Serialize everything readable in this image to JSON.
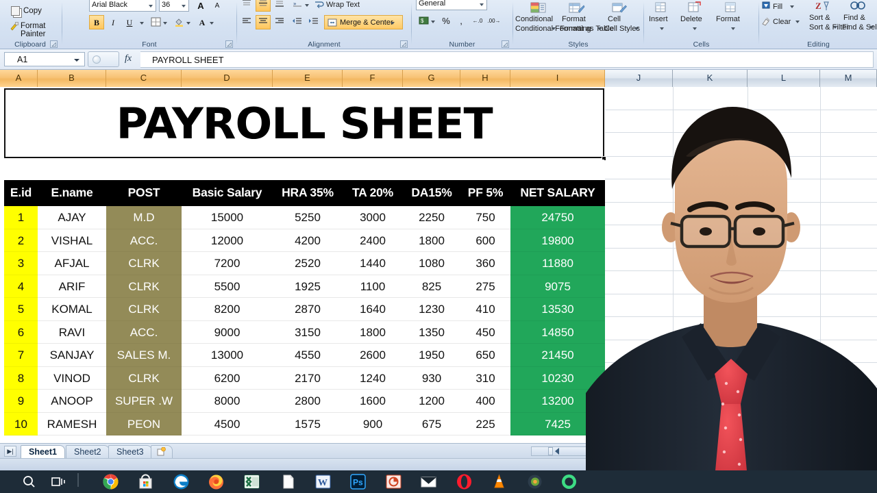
{
  "ribbon": {
    "groups": [
      {
        "name": "Clipboard",
        "label": "Clipboard"
      },
      {
        "name": "Font",
        "label": "Font"
      },
      {
        "name": "Alignment",
        "label": "Alignment"
      },
      {
        "name": "Number",
        "label": "Number"
      },
      {
        "name": "Styles",
        "label": "Styles"
      },
      {
        "name": "Cells",
        "label": "Cells"
      },
      {
        "name": "Editing",
        "label": "Editing"
      }
    ],
    "clipboard": {
      "copy": "Copy",
      "format_painter": "Format Painter"
    },
    "font": {
      "font_name": "Arial Black",
      "font_size": "36",
      "grow_font": "A",
      "shrink_font": "A",
      "bold": "B",
      "italic": "I",
      "underline": "U"
    },
    "alignment": {
      "wrap_text": "Wrap Text",
      "merge_center": "Merge & Center"
    },
    "number": {
      "format": "General",
      "percent": "%",
      "comma": ",",
      "increase_decimal": ".0",
      "decrease_decimal": ".00"
    },
    "styles": {
      "conditional_formatting": "Conditional Formatting",
      "format_as_table": "Format as Table",
      "cell_styles": "Cell Styles"
    },
    "cells": {
      "insert": "Insert",
      "delete": "Delete",
      "format": "Format"
    },
    "editing": {
      "fill": "Fill",
      "clear": "Clear",
      "sort_filter": "Sort & Filter",
      "find_select": "Find & Select"
    }
  },
  "formula_bar": {
    "name_box": "A1",
    "fx_label": "fx",
    "formula_value": "PAYROLL SHEET"
  },
  "grid": {
    "column_headers": [
      "A",
      "B",
      "C",
      "D",
      "E",
      "F",
      "G",
      "H",
      "I",
      "J",
      "K",
      "L",
      "M"
    ],
    "selected_columns": [
      "A",
      "B",
      "C",
      "D",
      "E",
      "F",
      "G",
      "H",
      "I"
    ],
    "title_cell": "PAYROLL SHEET"
  },
  "colors": {
    "id_fill": "#FFFF00",
    "post_fill": "#938B58",
    "net_salary_fill": "#21A75A",
    "header_fill": "#000000",
    "header_text": "#FFFFFF",
    "ribbon_highlight": "#FFC65C"
  },
  "chart_data": {
    "type": "table",
    "title": "PAYROLL SHEET",
    "columns": [
      "E.id",
      "E.name",
      "POST",
      "Basic Salary",
      "HRA 35%",
      "TA 20%",
      "DA15%",
      "PF 5%",
      "NET SALARY"
    ],
    "rows": [
      [
        "1",
        "AJAY",
        "M.D",
        "15000",
        "5250",
        "3000",
        "2250",
        "750",
        "24750"
      ],
      [
        "2",
        "VISHAL",
        "ACC.",
        "12000",
        "4200",
        "2400",
        "1800",
        "600",
        "19800"
      ],
      [
        "3",
        "AFJAL",
        "CLRK",
        "7200",
        "2520",
        "1440",
        "1080",
        "360",
        "11880"
      ],
      [
        "4",
        "ARIF",
        "CLRK",
        "5500",
        "1925",
        "1100",
        "825",
        "275",
        "9075"
      ],
      [
        "5",
        "KOMAL",
        "CLRK",
        "8200",
        "2870",
        "1640",
        "1230",
        "410",
        "13530"
      ],
      [
        "6",
        "RAVI",
        "ACC.",
        "9000",
        "3150",
        "1800",
        "1350",
        "450",
        "14850"
      ],
      [
        "7",
        "SANJAY",
        "SALES M.",
        "13000",
        "4550",
        "2600",
        "1950",
        "650",
        "21450"
      ],
      [
        "8",
        "VINOD",
        "CLRK",
        "6200",
        "2170",
        "1240",
        "930",
        "310",
        "10230"
      ],
      [
        "9",
        "ANOOP",
        "SUPER .W",
        "8000",
        "2800",
        "1600",
        "1200",
        "400",
        "13200"
      ],
      [
        "10",
        "RAMESH",
        "PEON",
        "4500",
        "1575",
        "900",
        "675",
        "225",
        "7425"
      ]
    ]
  },
  "sheet_tabs": {
    "nav_first": "▶|",
    "tabs": [
      "Sheet1",
      "Sheet2",
      "Sheet3"
    ],
    "active": "Sheet1",
    "new_sheet": "➕"
  },
  "taskbar": {
    "items": [
      {
        "name": "search-icon",
        "glyph": "⌕",
        "color": "#ffffff"
      },
      {
        "name": "task-view-icon",
        "glyph": "▤",
        "color": "#ffffff"
      },
      {
        "name": "chrome-icon",
        "glyph": "",
        "color": "#4285F4"
      },
      {
        "name": "microsoft-store-icon",
        "glyph": "",
        "color": "#F3F3F3"
      },
      {
        "name": "edge-icon",
        "glyph": "",
        "color": "#0B7EC8"
      },
      {
        "name": "firefox-icon",
        "glyph": "",
        "color": "#FF7139"
      },
      {
        "name": "excel-icon",
        "glyph": "X",
        "color": "#1D7044"
      },
      {
        "name": "file-explorer-icon",
        "glyph": "",
        "color": "#F5F5F5"
      },
      {
        "name": "word-icon",
        "glyph": "W",
        "color": "#2B579A"
      },
      {
        "name": "photoshop-icon",
        "glyph": "Ps",
        "color": "#31A8FF"
      },
      {
        "name": "powerpoint-icon",
        "glyph": "P",
        "color": "#D04423"
      },
      {
        "name": "mail-icon",
        "glyph": "✉",
        "color": "#FFFFFF"
      },
      {
        "name": "opera-icon",
        "glyph": "O",
        "color": "#FF1B2D"
      },
      {
        "name": "vlc-icon",
        "glyph": "▲",
        "color": "#FF8800"
      },
      {
        "name": "camtasia-icon",
        "glyph": "◉",
        "color": "#6BA539"
      },
      {
        "name": "browser-icon",
        "glyph": "●",
        "color": "#3DDC84"
      }
    ]
  }
}
